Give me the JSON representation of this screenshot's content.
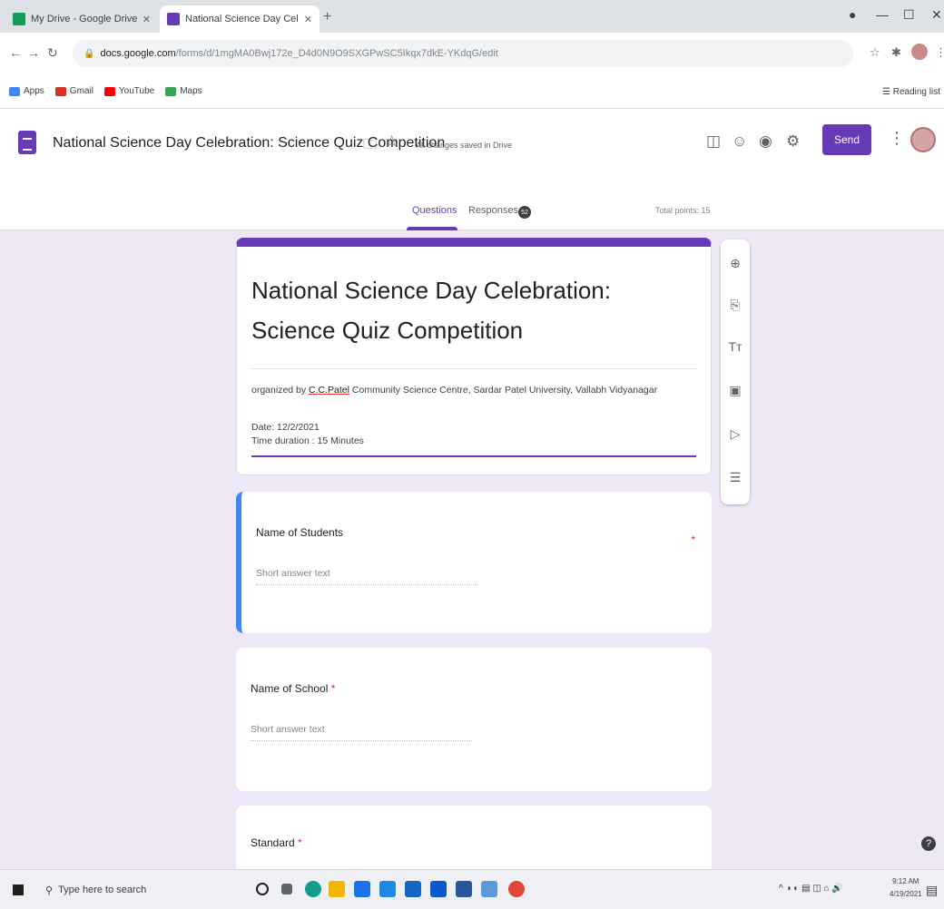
{
  "browser": {
    "tabs": [
      {
        "label": "My Drive - Google Drive",
        "favicon_color": "#0f9d58",
        "active": false
      },
      {
        "label": "National Science Day Celebratio",
        "favicon_color": "#673ab7",
        "active": true
      }
    ],
    "new_tab_label": "+",
    "url_host": "docs.google.com",
    "url_rest": "/forms/d/1mgMA0Bwj172e_D4d0N9O9SXGPwSC5Ikqx7dkE-YKdqG/edit",
    "bookmarks": [
      {
        "label": "Apps",
        "color": "#4285f4"
      },
      {
        "label": "Gmail",
        "color": "#d93025"
      },
      {
        "label": "YouTube",
        "color": "#ff0000"
      },
      {
        "label": "Maps",
        "color": "#34a853"
      }
    ],
    "reading_list": "Reading list"
  },
  "forms_header": {
    "title": "National Science Day Celebration: Science Quiz Competition",
    "saved_status": "All changes saved in Drive",
    "send_label": "Send",
    "tabs": [
      {
        "label": "Questions",
        "active": true
      },
      {
        "label": "Responses",
        "active": false
      }
    ],
    "responses_count": "52",
    "total_points": "Total points: 15",
    "accent": "#673ab7"
  },
  "form": {
    "title": "National Science Day Celebration: Science Quiz Competition",
    "desc_prefix": "organized by ",
    "desc_underlined": "C.C.Patel",
    "desc_suffix": " Community Science Centre, Sardar Patel University, Vallabh Vidyanagar",
    "date_line": "Date: 12/2/2021",
    "duration_line": "Time duration : 15 Minutes",
    "questions": [
      {
        "title": "Name of Students",
        "required_mark": "*",
        "placeholder": "Short answer text"
      },
      {
        "title": "Name of School",
        "required_mark": "*",
        "placeholder": "Short answer text"
      },
      {
        "title": "Standard",
        "required_mark": "*"
      }
    ]
  },
  "side_toolbar": {
    "icons": [
      "add-question-icon",
      "import-questions-icon",
      "add-title-icon",
      "add-image-icon",
      "add-video-icon",
      "add-section-icon"
    ]
  },
  "taskbar": {
    "search_placeholder": "Type here to search",
    "clock_time": "9:12 AM",
    "clock_date": "4/19/2021"
  }
}
